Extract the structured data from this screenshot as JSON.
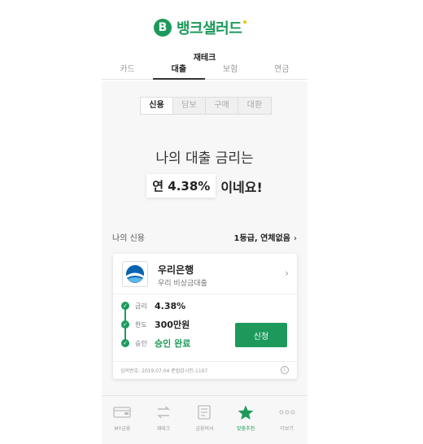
{
  "app": {
    "logo_letter": "B",
    "logo_text": "뱅크샐러드",
    "brand_color": "#1d9a5b",
    "accent_color": "#f3c300"
  },
  "header": {
    "section_title": "재테크"
  },
  "categories": [
    {
      "label": "카드",
      "active": false
    },
    {
      "label": "대출",
      "active": true
    },
    {
      "label": "보험",
      "active": false
    },
    {
      "label": "연금",
      "active": false
    }
  ],
  "loan_types": [
    {
      "label": "신용",
      "active": true
    },
    {
      "label": "담보",
      "active": false
    },
    {
      "label": "구매",
      "active": false
    },
    {
      "label": "대환",
      "active": false
    }
  ],
  "headline": {
    "line1": "나의 대출 금리는",
    "rate_prefix": "연",
    "rate": "4.38%",
    "suffix": "이네요!"
  },
  "credit": {
    "label": "나의 신용",
    "status": "1등급, 연체없음",
    "chevron": "›"
  },
  "offer": {
    "bank_name": "우리은행",
    "product": "우리 비상금대출",
    "chevron": "›",
    "steps": [
      {
        "label": "금리",
        "value": "4.38%"
      },
      {
        "label": "한도",
        "value": "300만원"
      },
      {
        "label": "승인",
        "value": "승인 완료"
      }
    ],
    "apply_label": "신청",
    "notice": "심의번호: 2019.07.04 준법감시인-1197",
    "info_icon": "ⓘ"
  },
  "nav": [
    {
      "label": "MY금융",
      "icon": "wallet-icon",
      "active": false
    },
    {
      "label": "재테크",
      "icon": "exchange-icon",
      "active": false
    },
    {
      "label": "금융비서",
      "icon": "document-icon",
      "active": false
    },
    {
      "label": "맞춤추천",
      "icon": "star-icon",
      "active": true
    },
    {
      "label": "더보기",
      "icon": "more-icon",
      "active": false
    }
  ]
}
